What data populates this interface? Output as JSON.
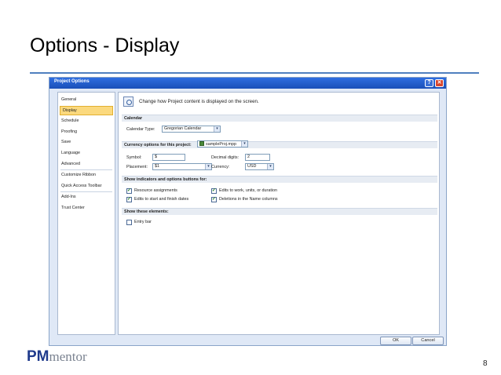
{
  "slide": {
    "title": "Options - Display",
    "page_number": "8",
    "logo": {
      "pm": "PM",
      "mentor": "mentor"
    },
    "accent_color": "#4f7fbf"
  },
  "dialog": {
    "title": "Project Options",
    "help_glyph": "?",
    "close_glyph": "✕",
    "nav_items": [
      "General",
      "Display",
      "Schedule",
      "Proofing",
      "Save",
      "Language",
      "Advanced",
      "Customize Ribbon",
      "Quick Access Toolbar",
      "Add-Ins",
      "Trust Center"
    ],
    "active_nav": "Display",
    "header_text": "Change how Project content is displayed on the screen.",
    "calendar": {
      "section": "Calendar",
      "type_label": "Calendar Type:",
      "type_value": "Gregorian Calendar"
    },
    "currency": {
      "section": "Currency options for this project:",
      "project_value": "sampleProj.mpp",
      "symbol_label": "Symbol:",
      "symbol_value": "$",
      "placement_label": "Placement:",
      "placement_value": "$1",
      "decimal_label": "Decimal digits:",
      "decimal_value": "2",
      "currency_label": "Currency:",
      "currency_value": "USD"
    },
    "indicators": {
      "section": "Show indicators and options buttons for:",
      "items": [
        {
          "label": "Resource assignments",
          "checked": true
        },
        {
          "label": "Edits to start and finish dates",
          "checked": true
        },
        {
          "label": "Edits to work, units, or duration",
          "checked": true
        },
        {
          "label": "Deletions in the Name columns",
          "checked": true
        }
      ]
    },
    "elements": {
      "section": "Show these elements:",
      "entry_bar_label": "Entry bar",
      "entry_bar_checked": false
    },
    "ok_label": "OK",
    "cancel_label": "Cancel",
    "dropdown_glyph": "▾",
    "check_glyph": "✓",
    "icons": [
      "display-magnifier-icon",
      "project-file-icon",
      "help-icon",
      "close-icon",
      "chevron-down-icon",
      "checkmark-icon"
    ]
  }
}
